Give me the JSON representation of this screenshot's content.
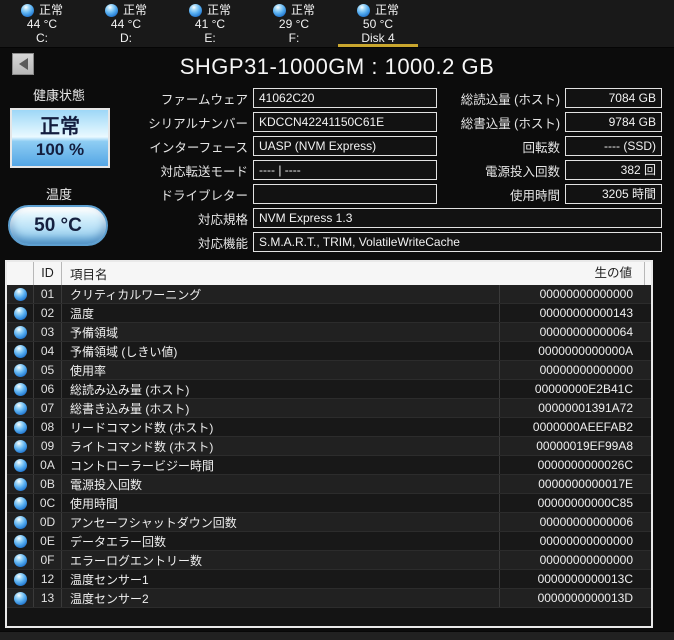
{
  "window": {
    "title": "SHGP31-1000GM : 1000.2 GB"
  },
  "tabs": [
    {
      "status": "正常",
      "temp": "44 °C",
      "label": "C:",
      "selected": false
    },
    {
      "status": "正常",
      "temp": "44 °C",
      "label": "D:",
      "selected": false
    },
    {
      "status": "正常",
      "temp": "41 °C",
      "label": "E:",
      "selected": false
    },
    {
      "status": "正常",
      "temp": "29 °C",
      "label": "F:",
      "selected": false
    },
    {
      "status": "正常",
      "temp": "50 °C",
      "label": "Disk 4",
      "selected": true
    }
  ],
  "health": {
    "label": "健康状態",
    "status": "正常",
    "percent": "100 %"
  },
  "temperature": {
    "label": "温度",
    "value": "50 °C"
  },
  "fields_left": [
    {
      "label": "ファームウェア",
      "value": "41062C20"
    },
    {
      "label": "シリアルナンバー",
      "value": "KDCCN42241150C61E"
    },
    {
      "label": "インターフェース",
      "value": "UASP (NVM Express)"
    },
    {
      "label": "対応転送モード",
      "value": "---- | ----"
    },
    {
      "label": "ドライブレター",
      "value": ""
    }
  ],
  "fields_right": [
    {
      "label": "総読込量 (ホスト)",
      "value": "7084 GB"
    },
    {
      "label": "総書込量 (ホスト)",
      "value": "9784 GB"
    },
    {
      "label": "回転数",
      "value": "---- (SSD)"
    },
    {
      "label": "電源投入回数",
      "value": "382 回"
    },
    {
      "label": "使用時間",
      "value": "3205 時間"
    }
  ],
  "fields_wide": [
    {
      "label": "対応規格",
      "value": "NVM Express 1.3"
    },
    {
      "label": "対応機能",
      "value": "S.M.A.R.T., TRIM, VolatileWriteCache"
    }
  ],
  "smart_table": {
    "headers": {
      "id": "ID",
      "name": "項目名",
      "raw": "生の値"
    },
    "rows": [
      {
        "id": "01",
        "name": "クリティカルワーニング",
        "raw": "00000000000000"
      },
      {
        "id": "02",
        "name": "温度",
        "raw": "00000000000143"
      },
      {
        "id": "03",
        "name": "予備領域",
        "raw": "00000000000064"
      },
      {
        "id": "04",
        "name": "予備領域 (しきい値)",
        "raw": "0000000000000A"
      },
      {
        "id": "05",
        "name": "使用率",
        "raw": "00000000000000"
      },
      {
        "id": "06",
        "name": "総読み込み量 (ホスト)",
        "raw": "00000000E2B41C"
      },
      {
        "id": "07",
        "name": "総書き込み量 (ホスト)",
        "raw": "00000001391A72"
      },
      {
        "id": "08",
        "name": "リードコマンド数 (ホスト)",
        "raw": "0000000AEEFAB2"
      },
      {
        "id": "09",
        "name": "ライトコマンド数 (ホスト)",
        "raw": "00000019EF99A8"
      },
      {
        "id": "0A",
        "name": "コントローラービジー時間",
        "raw": "0000000000026C"
      },
      {
        "id": "0B",
        "name": "電源投入回数",
        "raw": "0000000000017E"
      },
      {
        "id": "0C",
        "name": "使用時間",
        "raw": "00000000000C85"
      },
      {
        "id": "0D",
        "name": "アンセーフシャットダウン回数",
        "raw": "00000000000006"
      },
      {
        "id": "0E",
        "name": "データエラー回数",
        "raw": "00000000000000"
      },
      {
        "id": "0F",
        "name": "エラーログエントリー数",
        "raw": "00000000000000"
      },
      {
        "id": "12",
        "name": "温度センサー1",
        "raw": "0000000000013C"
      },
      {
        "id": "13",
        "name": "温度センサー2",
        "raw": "0000000000013D"
      }
    ]
  },
  "colors": {
    "selected_tab_underline": "#c9a62e",
    "status_orb_blue": "#2e8fe0",
    "health_button_blue": "#54a6e5",
    "health_text_navy": "#131d3e",
    "table_header_bg": "#f6f6f6",
    "background": "#0c0c0c"
  }
}
